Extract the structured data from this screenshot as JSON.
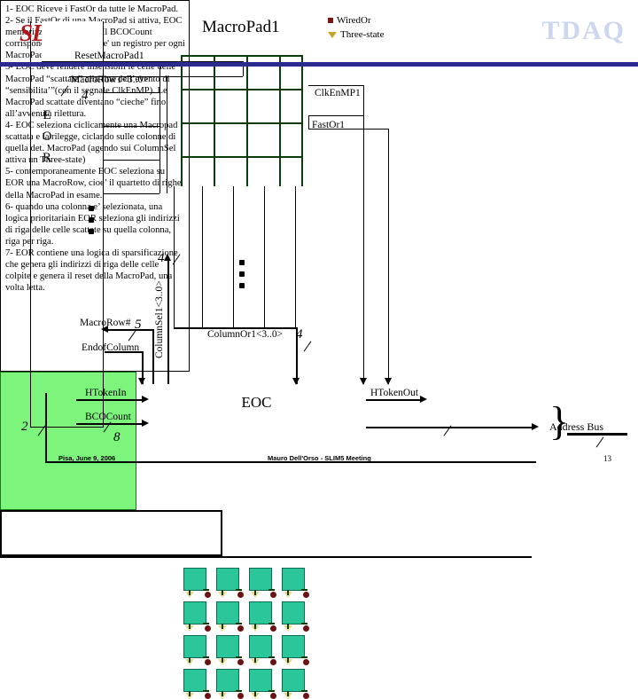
{
  "slide": {
    "logo_text": "SLIM5",
    "watermark": "TDAQ",
    "page_number": "13",
    "footer_left": "Pisa, June 9, 2006",
    "footer_right": "Mauro Dell'Orso - SLIM5 Meeting"
  },
  "titles": {
    "macropad": "MacroPad1",
    "eor": [
      "E",
      "O",
      "R"
    ],
    "eoc": "EOC"
  },
  "legend": {
    "wired_or": "WiredOr",
    "three_state": "Three-state",
    "wired_or_color": "#7a1515",
    "three_state_color": "#c8a62e"
  },
  "signals": {
    "reset_macropad1": "ResetMacroPad1",
    "macrorow1": "MacroRow1<3..0>",
    "macrorow1_width": "4",
    "clk_en_mp1": "ClkEnMP1",
    "fast_or1": "FastOr1",
    "macrorow_hash": "MacroRow#",
    "macrorow_hash_width": "5",
    "end_of_column": "EndofColumn",
    "column_sel1": "ColumnSel1<3..0>",
    "column_sel1_width": "4",
    "column_or1": "ColumnOr1<3..0>",
    "column_or1_width": "4",
    "eor_out_width": "4",
    "htoken_in": "HTokenIn",
    "htoken_out": "HTokenOut",
    "bcocount": "BCOCount",
    "bcocount_width": "8",
    "eor_left_width": "2",
    "address_bus": "Address Bus"
  },
  "macropad": {
    "rows": 4,
    "cols": 4,
    "cell_fill": "#2bc79a",
    "pad_fill": "#7df57d"
  },
  "notes": {
    "lines": [
      "1- EOC Riceve i FastOr da tutte le MacroPad.",
      "2- Se il FastOr di una MacroPad si attiva, EOC memorizza in un registro Il BCOCount corrispondente (in EOC c'e' un registro per ogni MacroPad).",
      "3- EOC deve rendere insensibili le celle delle MacroPad “scattate” alla fine dell’evento di “sensibilita’”(con il segnale ClkEnMP). Le MacroPad scattate diventano “cieche” fino all’avvenuta rilettura.",
      "4- EOC seleziona ciclicamente una Macropad scattata e la rilegge, ciclando sulle colonne di quella det. MacroPad (agendo sui ColumnSel attiva un Three-state)",
      "5- contemporaneamente EOC seleziona su EOR una MacroRow, cioe’ il quartetto di righe della MacroPad in esame.",
      "6- quando una colonna e’ selezionata, una logica prioritariain EOR seleziona gli indirizzi di riga delle celle scattate su quella colonna, riga per riga.",
      "7- EOR contiene una logica di sparsificazione che genera gli indirizzi di riga delle celle colpite  e genera il reset della MacroPad, una volta letta."
    ]
  }
}
